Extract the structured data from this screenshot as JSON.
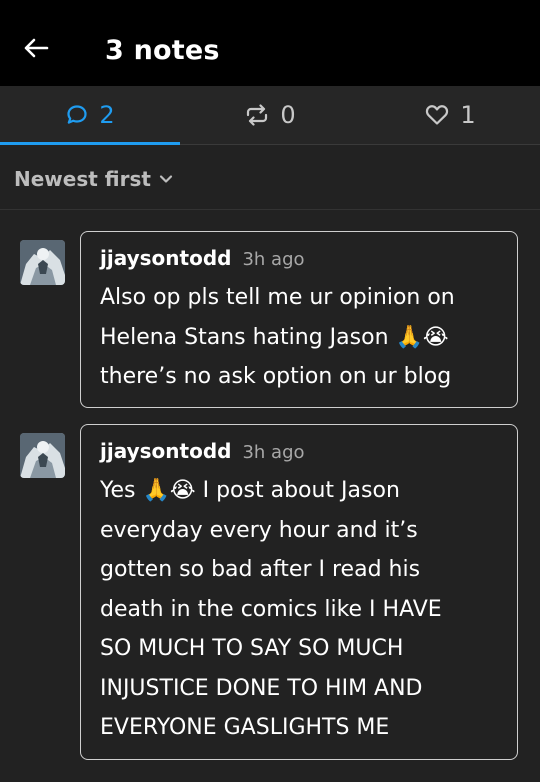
{
  "header": {
    "back_icon": "arrow-left-icon",
    "title": "3 notes"
  },
  "tabs": [
    {
      "icon": "comment-icon",
      "count": "2",
      "active": true
    },
    {
      "icon": "reblog-icon",
      "count": "0",
      "active": false
    },
    {
      "icon": "heart-icon",
      "count": "1",
      "active": false
    }
  ],
  "sort": {
    "label": "Newest first",
    "icon": "chevron-down-icon"
  },
  "notes": [
    {
      "username": "jjaysontodd",
      "time": "3h ago",
      "text": "Also op pls tell me ur opinion on\nHelena Stans hating Jason 🙏😭\nthere’s no ask option on ur blog"
    },
    {
      "username": "jjaysontodd",
      "time": "3h ago",
      "text": "Yes 🙏😭 I post about Jason\neveryday every hour and it’s\ngotten so bad after I read his\ndeath in the comics like I HAVE\nSO MUCH TO SAY SO MUCH\nINJUSTICE DONE TO HIM AND\nEVERYONE GASLIGHTS ME"
    }
  ],
  "colors": {
    "accent": "#1f9cf0",
    "background": "#222222",
    "header": "#000000"
  }
}
